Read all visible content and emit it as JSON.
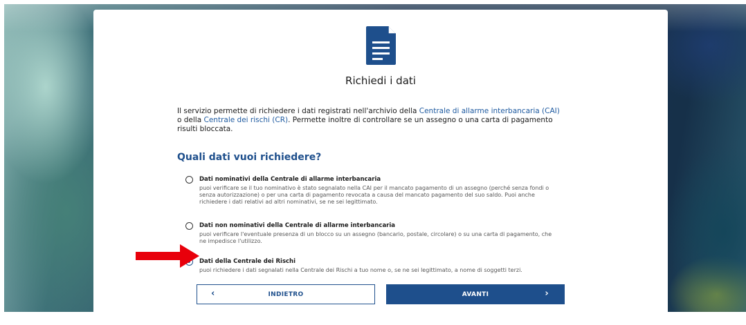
{
  "page": {
    "title": "Richiedi i dati",
    "icon": "document-icon"
  },
  "intro": {
    "text_1": "Il servizio permette di richiedere i dati registrati nell'archivio della ",
    "link_cai": "Centrale di allarme interbancaria (CAI)",
    "text_2": " o della ",
    "link_cr": "Centrale dei rischi (CR)",
    "text_3": ". Permette inoltre di controllare se un assegno o una carta di pagamento risulti bloccata."
  },
  "question": {
    "title": "Quali dati vuoi richiedere?",
    "options": [
      {
        "label": "Dati nominativi della Centrale di allarme interbancaria",
        "description": "puoi verificare se il tuo nominativo è stato segnalato nella CAI per il mancato pagamento di un assegno (perché senza fondi o senza autorizzazione) o per una carta di pagamento revocata a causa del mancato pagamento del suo saldo. Puoi anche richiedere i dati relativi ad altri nominativi, se ne sei legittimato.",
        "selected": false
      },
      {
        "label": "Dati non nominativi della Centrale di allarme interbancaria",
        "description": "puoi verificare l'eventuale presenza di un blocco su un assegno (bancario, postale, circolare) o su una carta di pagamento, che ne impedisce l'utilizzo.",
        "selected": false
      },
      {
        "label": "Dati della Centrale dei Rischi",
        "description": "puoi richiedere i dati segnalati nella Centrale dei Rischi a tuo nome o, se ne sei legittimato, a nome di soggetti terzi.",
        "selected": true
      }
    ]
  },
  "buttons": {
    "back_label": "INDIETRO",
    "next_label": "AVANTI",
    "back_icon": "chevron-left-icon",
    "next_icon": "chevron-right-icon"
  },
  "colors": {
    "accent": "#1e4f8c",
    "link": "#1e5aa0",
    "arrow": "#e8000b"
  }
}
